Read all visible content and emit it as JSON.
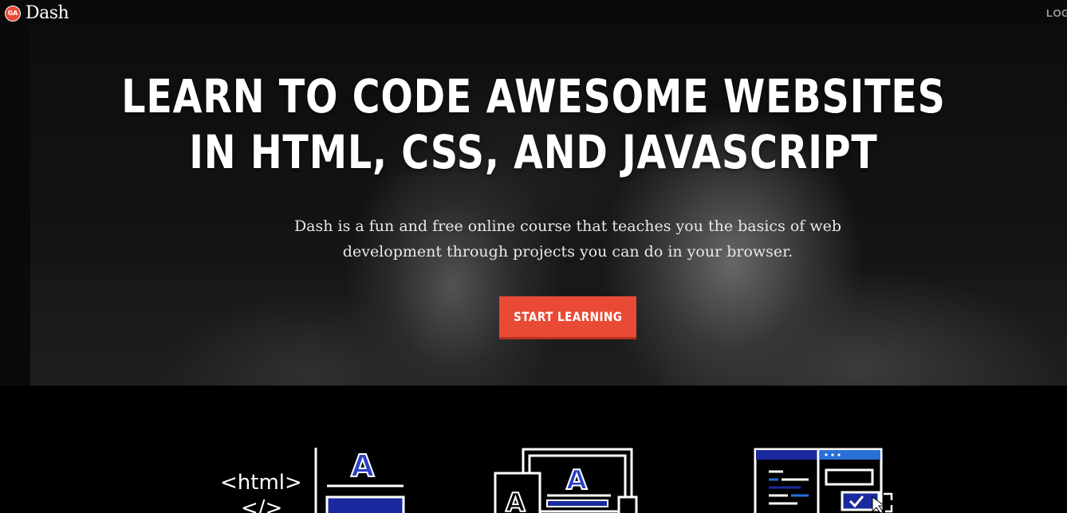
{
  "header": {
    "brand_badge": "GA",
    "brand_name": "Dash",
    "login_label": "LOGIN"
  },
  "hero": {
    "headline_line1": "LEARN TO CODE AWESOME WEBSITES",
    "headline_line2": "IN HTML, CSS, AND JAVASCRIPT",
    "subtitle_line1": "Dash is a fun and free online course that teaches you the basics of web",
    "subtitle_line2": "development through projects you can do in your browser.",
    "cta_label": "START LEARNING"
  },
  "features": {
    "icons": [
      "html-code-icon",
      "layout-css-icon",
      "browser-javascript-icon"
    ],
    "html_icon_text": "<html>",
    "html_icon_text2": "</>",
    "letter": "A"
  },
  "colors": {
    "accent": "#e84a35",
    "icon_blue": "#2a3fc8",
    "background": "#000000"
  }
}
